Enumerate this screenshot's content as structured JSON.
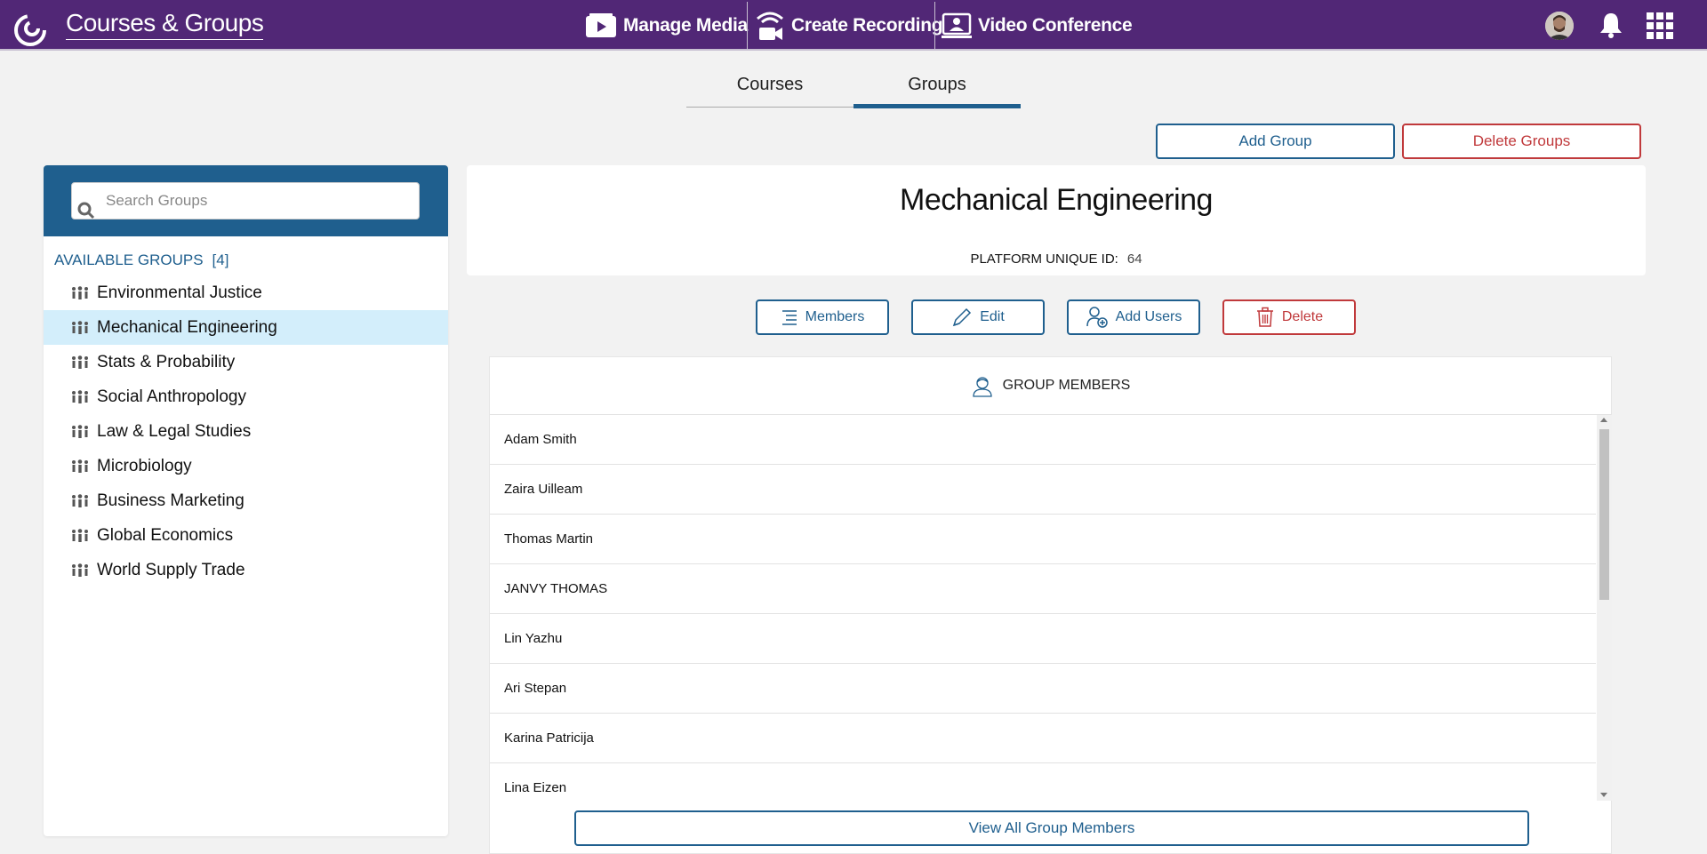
{
  "header": {
    "app_title": "Courses & Groups",
    "nav": [
      {
        "label": "Manage Media",
        "icon": "media-icon"
      },
      {
        "label": "Create Recording",
        "icon": "recording-icon"
      },
      {
        "label": "Video Conference",
        "icon": "video-conference-icon"
      }
    ],
    "accent_color": "#512776"
  },
  "tabs": [
    {
      "label": "Courses",
      "active": false
    },
    {
      "label": "Groups",
      "active": true
    }
  ],
  "toolbar": {
    "add_group_label": "Add Group",
    "delete_groups_label": "Delete Groups"
  },
  "sidebar": {
    "search_placeholder": "Search Groups",
    "available_label": "AVAILABLE GROUPS",
    "available_count": "[4]",
    "groups": [
      {
        "label": "Environmental Justice",
        "selected": false
      },
      {
        "label": "Mechanical Engineering",
        "selected": true
      },
      {
        "label": "Stats & Probability",
        "selected": false
      },
      {
        "label": "Social Anthropology",
        "selected": false
      },
      {
        "label": "Law & Legal Studies",
        "selected": false
      },
      {
        "label": "Microbiology",
        "selected": false
      },
      {
        "label": "Business Marketing",
        "selected": false
      },
      {
        "label": "Global Economics",
        "selected": false
      },
      {
        "label": "World Supply Trade",
        "selected": false
      }
    ]
  },
  "detail": {
    "title": "Mechanical Engineering",
    "uid_label": "PLATFORM UNIQUE ID:",
    "uid_value": "64",
    "actions": {
      "members": "Members",
      "edit": "Edit",
      "add_users": "Add Users",
      "delete": "Delete"
    },
    "members_header": "GROUP MEMBERS",
    "members": [
      "Adam Smith",
      "Zaira Uilleam",
      "Thomas Martin",
      "JANVY THOMAS",
      "Lin Yazhu",
      "Ari Stepan",
      "Karina Patricija",
      "Lina Eizen"
    ],
    "view_all_label": "View All Group Members"
  },
  "colors": {
    "primary": "#1f5f8e",
    "danger": "#c0393b",
    "selected_row": "#d3eefb"
  }
}
